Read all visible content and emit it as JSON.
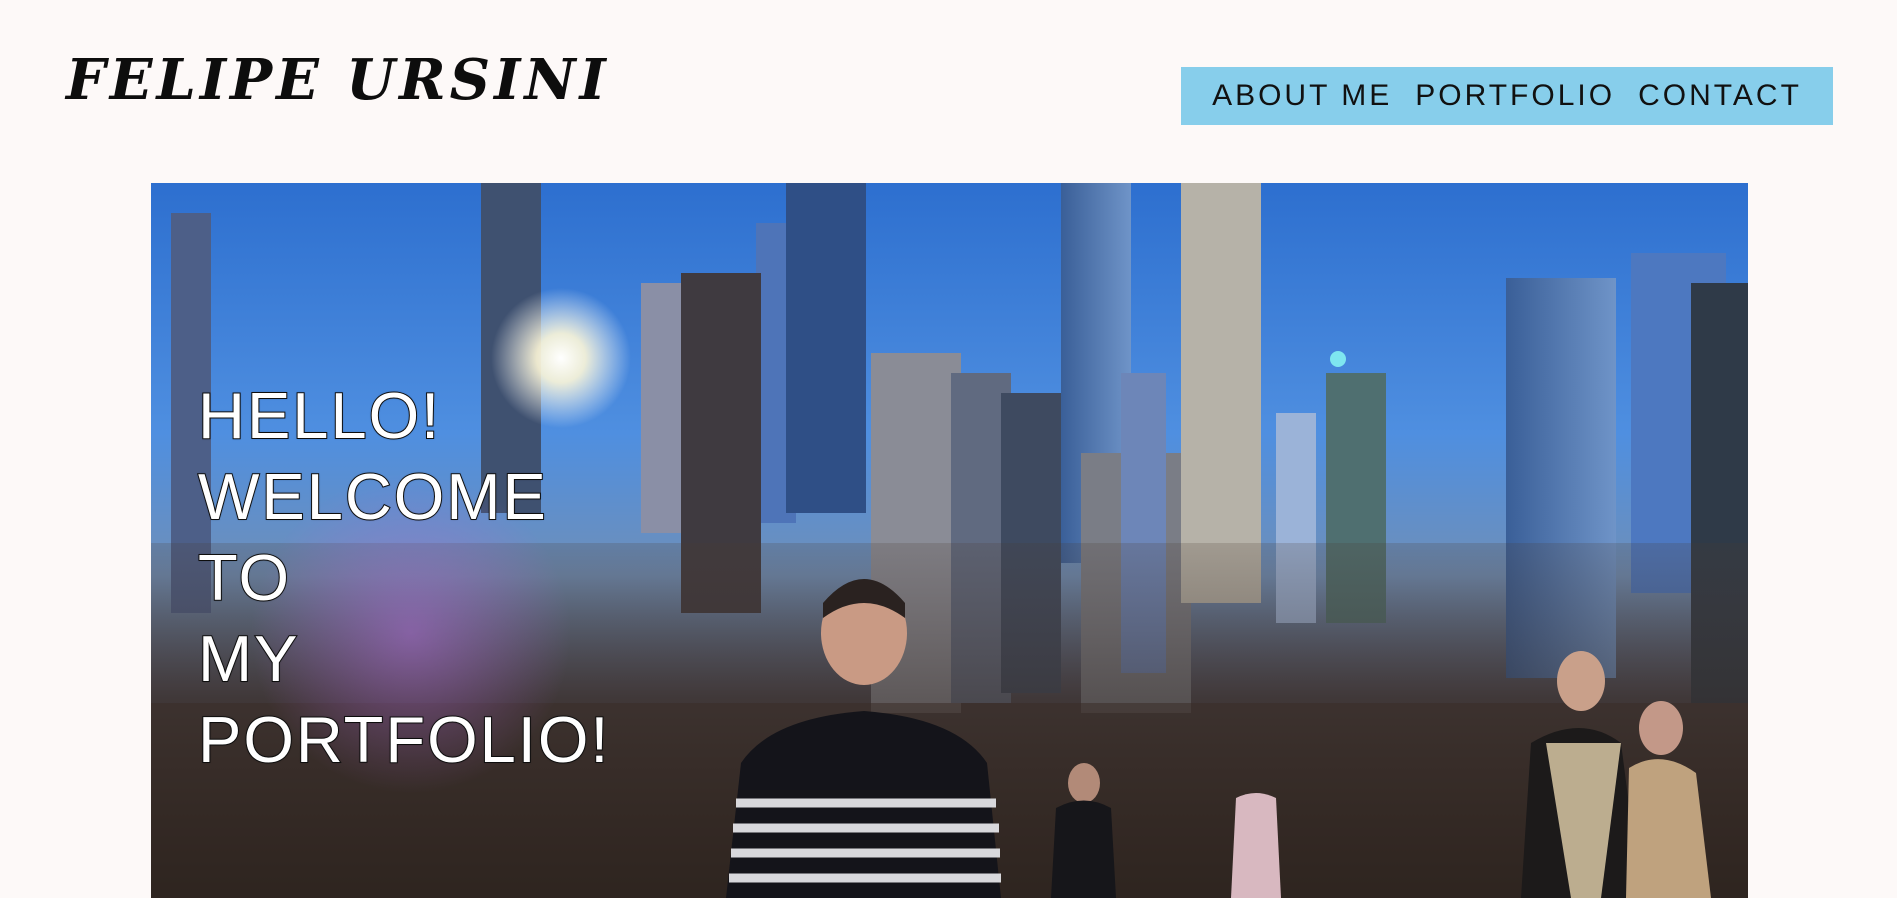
{
  "header": {
    "site_title": "FELIPE URSINI"
  },
  "nav": {
    "items": [
      {
        "label": "ABOUT ME"
      },
      {
        "label": "PORTFOLIO"
      },
      {
        "label": "CONTACT"
      }
    ],
    "background_color": "#87ceeb"
  },
  "hero": {
    "image_description_icon": "city-skyline-photo",
    "welcome_lines": [
      "HELLO!",
      "WELCOME",
      "TO",
      "MY",
      "PORTFOLIO!"
    ]
  },
  "colors": {
    "page_background": "#fdf9f8",
    "title_text": "#0d0d0d"
  }
}
